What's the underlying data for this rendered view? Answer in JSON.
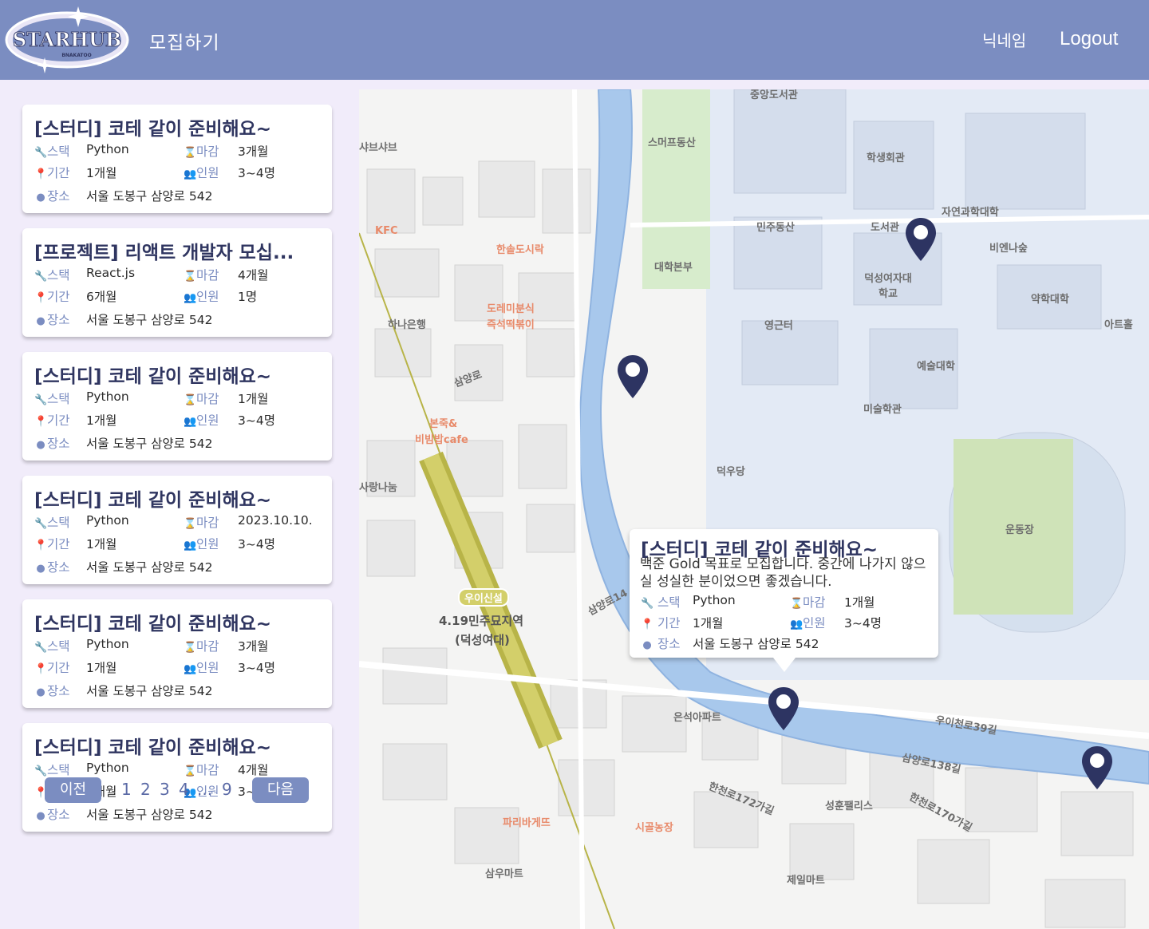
{
  "header": {
    "logo_text": "STARHUB",
    "logo_sub": "BNAKATOO",
    "nav_recruit": "모집하기",
    "nav_nickname": "닉네임",
    "nav_logout": "Logout"
  },
  "labels": {
    "stack": "스택",
    "deadline": "마감",
    "period": "기간",
    "members": "인원",
    "place": "장소"
  },
  "posts": [
    {
      "title": "[스터디] 코테 같이 준비해요~",
      "stack": "Python",
      "deadline": "3개월",
      "period": "1개월",
      "members": "3~4명",
      "place": "서울 도봉구 삼양로 542"
    },
    {
      "title": "[프로젝트] 리액트 개발자 모십...",
      "stack": "React.js",
      "deadline": "4개월",
      "period": "6개월",
      "members": "1명",
      "place": "서울 도봉구 삼양로 542"
    },
    {
      "title": "[스터디] 코테 같이 준비해요~",
      "stack": "Python",
      "deadline": "1개월",
      "period": "1개월",
      "members": "3~4명",
      "place": "서울 도봉구 삼양로 542"
    },
    {
      "title": "[스터디] 코테 같이 준비해요~",
      "stack": "Python",
      "deadline": "2023.10.10.",
      "period": "1개월",
      "members": "3~4명",
      "place": "서울 도봉구 삼양로 542"
    },
    {
      "title": "[스터디] 코테 같이 준비해요~",
      "stack": "Python",
      "deadline": "3개월",
      "period": "1개월",
      "members": "3~4명",
      "place": "서울 도봉구 삼양로 542"
    },
    {
      "title": "[스터디] 코테 같이 준비해요~",
      "stack": "Python",
      "deadline": "4개월",
      "period": "1개월",
      "members": "3~4명",
      "place": "서울 도봉구 삼양로 542"
    }
  ],
  "pagination": {
    "prev": "이전",
    "next": "다음",
    "pages": [
      "1",
      "2",
      "3",
      "4",
      "...",
      "9"
    ]
  },
  "popup": {
    "title": "[스터디] 코테 같이 준비해요~",
    "description": "백준 Gold 목표로 모집합니다. 중간에 나가지 않으실 성실한 분이었으면 좋겠습니다.",
    "stack": "Python",
    "deadline": "1개월",
    "period": "1개월",
    "members": "3~4명",
    "place": "서울 도봉구 삼양로 542"
  },
  "map_labels": {
    "l1": "중앙도서관",
    "l2": "스머프동산",
    "l3": "학생회관",
    "l4": "자연과학대학",
    "l5": "민주동산",
    "l6": "도서관",
    "l7": "비엔나숲",
    "l8": "대학본부",
    "l9": "덕성여자대학교",
    "l10": "약학대학",
    "l11": "영근터",
    "l12": "아트홀",
    "l13": "예술대학",
    "l14": "미술학관",
    "l15": "덕우당",
    "l16": "운동장",
    "l17": "은석아파트",
    "l18": "우이천로39길",
    "l19": "삼양로138길",
    "l20": "성훈팰리스",
    "l21": "한천로172가길",
    "l22": "한천로170가길",
    "l23": "시골농장",
    "l24": "제일마트",
    "l25": "파리바게뜨",
    "l26": "삼우마트",
    "l27": "4.19민주묘지역",
    "l28": "(덕성여대)",
    "l29": "우이신설",
    "l30": "하나은행",
    "l31": "KFC",
    "l32": "한솥도시락",
    "l33": "도레미분식",
    "l34": "즉석떡볶이",
    "l35": "본죽&",
    "l36": "비빔밥cafe",
    "l37": "사랑나눔",
    "l38": "샤브샤브",
    "l39": "삼양로",
    "l40": "삼양로14"
  },
  "colors": {
    "header": "#7b8dc1",
    "accent": "#7b8dc1",
    "title": "#2f3560",
    "marker": "#2d3462",
    "river": "#a8c8ec",
    "rail": "#b8b448"
  }
}
